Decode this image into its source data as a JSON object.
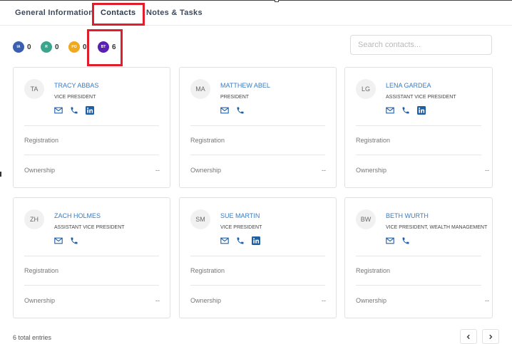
{
  "tabs": [
    {
      "label": "General Information"
    },
    {
      "label": "Contacts"
    },
    {
      "label": "Notes & Tasks"
    }
  ],
  "badges": [
    {
      "abbr": "IA",
      "count": "0",
      "color": "#3b5fb0"
    },
    {
      "abbr": "R",
      "count": "0",
      "color": "#3aa58c"
    },
    {
      "abbr": "PO",
      "count": "0",
      "color": "#f0a81f"
    },
    {
      "abbr": "BT",
      "count": "6",
      "color": "#5a20b3"
    }
  ],
  "search": {
    "placeholder": "Search contacts..."
  },
  "contacts": [
    {
      "initials": "TA",
      "name": "TRACY ABBAS",
      "title": "VICE PRESIDENT",
      "registration_label": "Registration",
      "ownership_label": "Ownership",
      "ownership_value": "--"
    },
    {
      "initials": "MA",
      "name": "MATTHEW ABEL",
      "title": "PRESIDENT",
      "registration_label": "Registration",
      "ownership_label": "Ownership",
      "ownership_value": "--"
    },
    {
      "initials": "LG",
      "name": "LENA GARDEA",
      "title": "ASSISTANT VICE PRESIDENT",
      "registration_label": "Registration",
      "ownership_label": "Ownership",
      "ownership_value": "--"
    },
    {
      "initials": "ZH",
      "name": "ZACH HOLMES",
      "title": "ASSISTANT VICE PRESIDENT",
      "registration_label": "Registration",
      "ownership_label": "Ownership",
      "ownership_value": "--"
    },
    {
      "initials": "SM",
      "name": "SUE MARTIN",
      "title": "VICE PRESIDENT",
      "registration_label": "Registration",
      "ownership_label": "Ownership",
      "ownership_value": "--"
    },
    {
      "initials": "BW",
      "name": "BETH WURTH",
      "title": "VICE PRESIDENT, WEALTH MANAGEMENT",
      "registration_label": "Registration",
      "ownership_label": "Ownership",
      "ownership_value": "--"
    }
  ],
  "footer": {
    "total_text": "6 total entries"
  },
  "pagination": {
    "prev": "‹",
    "next": "›"
  },
  "colors": {
    "link": "#3a7bbf",
    "icon": "#1e5fa6",
    "highlight": "#e01d2b"
  }
}
